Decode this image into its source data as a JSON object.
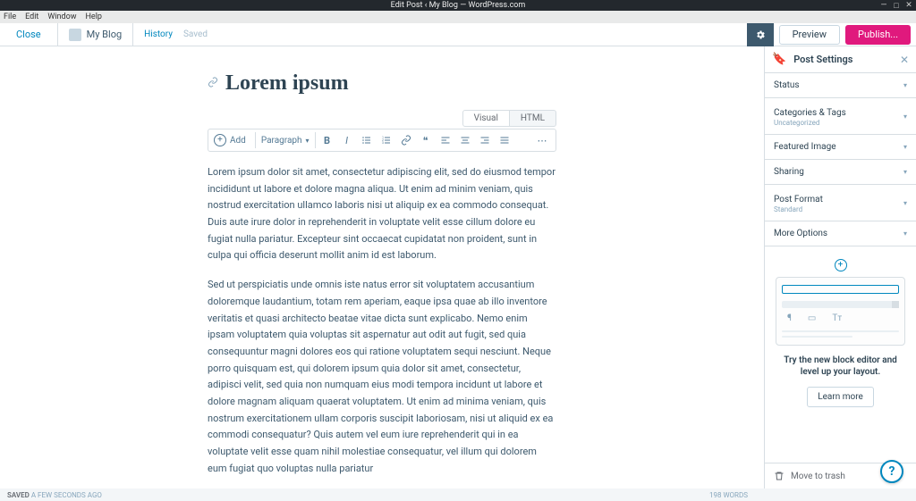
{
  "titlebar": {
    "title": "Edit Post ‹ My Blog — WordPress.com"
  },
  "menubar": {
    "items": [
      "File",
      "Edit",
      "Window",
      "Help"
    ]
  },
  "topbar": {
    "close": "Close",
    "site_name": "My Blog",
    "history": "History",
    "saved": "Saved",
    "preview": "Preview",
    "publish": "Publish..."
  },
  "editor": {
    "title": "Lorem ipsum",
    "tabs": {
      "visual": "Visual",
      "html": "HTML"
    },
    "toolbar": {
      "add": "Add",
      "format": "Paragraph"
    },
    "paragraphs": [
      "Lorem ipsum dolor sit amet, consectetur adipiscing elit, sed do eiusmod tempor incididunt ut labore et dolore magna aliqua. Ut enim ad minim veniam, quis nostrud exercitation ullamco laboris nisi ut aliquip ex ea commodo consequat. Duis aute irure dolor in reprehenderit in voluptate velit esse cillum dolore eu fugiat nulla pariatur. Excepteur sint occaecat cupidatat non proident, sunt in culpa qui officia deserunt mollit anim id est laborum.",
      "Sed ut perspiciatis unde omnis iste natus error sit voluptatem accusantium doloremque laudantium, totam rem aperiam, eaque ipsa quae ab illo inventore veritatis et quasi architecto beatae vitae dicta sunt explicabo. Nemo enim ipsam voluptatem quia voluptas sit aspernatur aut odit aut fugit, sed quia consequuntur magni dolores eos qui ratione voluptatem sequi nesciunt. Neque porro quisquam est, qui dolorem ipsum quia dolor sit amet, consectetur, adipisci velit, sed quia non numquam eius modi tempora incidunt ut labore et dolore magnam aliquam quaerat voluptatem. Ut enim ad minima veniam, quis nostrum exercitationem ullam corporis suscipit laboriosam, nisi ut aliquid ex ea commodi consequatur? Quis autem vel eum iure reprehenderit qui in ea voluptate velit esse quam nihil molestiae consequatur, vel illum qui dolorem eum fugiat quo voluptas nulla pariatur"
    ]
  },
  "sidebar": {
    "title": "Post Settings",
    "sections": [
      {
        "label": "Status",
        "sub": ""
      },
      {
        "label": "Categories & Tags",
        "sub": "Uncategorized"
      },
      {
        "label": "Featured Image",
        "sub": ""
      },
      {
        "label": "Sharing",
        "sub": ""
      },
      {
        "label": "Post Format",
        "sub": "Standard"
      },
      {
        "label": "More Options",
        "sub": ""
      }
    ],
    "promo": {
      "text": "Try the new block editor and level up your layout.",
      "button": "Learn more"
    },
    "trash": "Move to trash"
  },
  "statusbar": {
    "left_bold": "SAVED",
    "left_rest": " A FEW SECONDS AGO",
    "right": "198 WORDS"
  },
  "help": "?"
}
